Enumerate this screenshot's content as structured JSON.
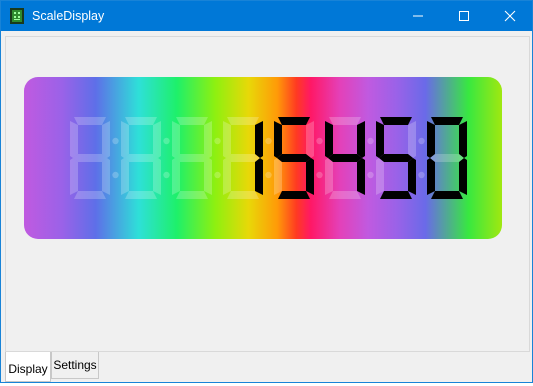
{
  "window": {
    "title": "ScaleDisplay",
    "icon": "lcd-app-icon",
    "controls": [
      "minimize-icon",
      "maximize-icon",
      "close-icon"
    ]
  },
  "display": {
    "digit_count": 8,
    "value": "15450",
    "inactive_segment_color": "rgba(255,255,255,0.22)",
    "active_segment_color": "#000000"
  },
  "tabs": [
    {
      "label": "Display",
      "active": true
    },
    {
      "label": "Settings",
      "active": false
    }
  ]
}
